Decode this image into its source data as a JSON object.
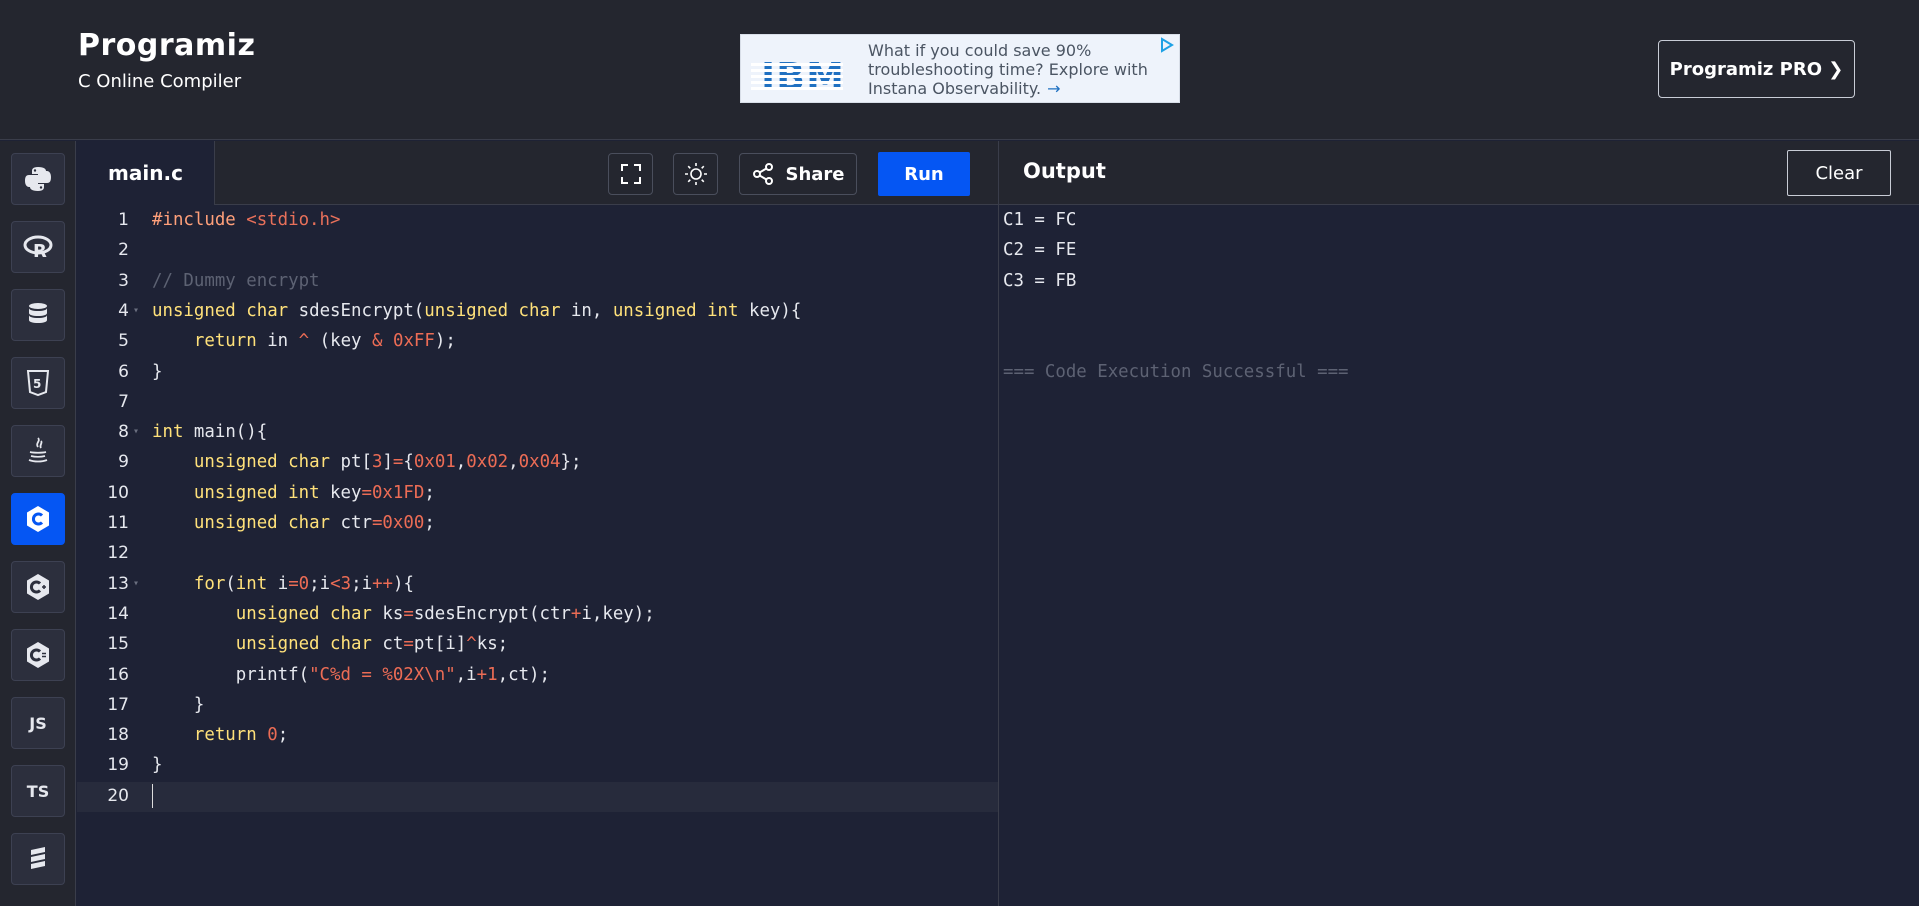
{
  "header": {
    "logo": "Programiz",
    "subtitle": "C Online Compiler",
    "pro_button": "Programiz PRO ❯"
  },
  "ad": {
    "brand": "IBM",
    "text": "What if you could save 90% troubleshooting time? Explore with Instana Observability.",
    "arrow": "→",
    "brand_color": "#1f70c1"
  },
  "sidebar": {
    "items": [
      {
        "name": "python",
        "icon": "python-icon"
      },
      {
        "name": "r",
        "icon": "r-icon"
      },
      {
        "name": "sql",
        "icon": "database-icon"
      },
      {
        "name": "html",
        "icon": "html5-icon"
      },
      {
        "name": "java",
        "icon": "java-icon"
      },
      {
        "name": "c",
        "icon": "c-icon",
        "active": true
      },
      {
        "name": "cpp",
        "icon": "cpp-icon"
      },
      {
        "name": "csharp",
        "icon": "csharp-icon"
      },
      {
        "name": "js",
        "label": "JS"
      },
      {
        "name": "ts",
        "label": "TS"
      },
      {
        "name": "swift",
        "icon": "stack-icon"
      }
    ]
  },
  "editor": {
    "tab": "main.c",
    "share_label": "Share",
    "run_label": "Run",
    "current_line": 20,
    "lines": [
      "#include <stdio.h>",
      "",
      "// Dummy encrypt",
      "unsigned char sdesEncrypt(unsigned char in, unsigned int key){",
      "    return in ^ (key & 0xFF);",
      "}",
      "",
      "int main(){",
      "    unsigned char pt[3]={0x01,0x02,0x04};",
      "    unsigned int key=0x1FD;",
      "    unsigned char ctr=0x00;",
      "",
      "    for(int i=0;i<3;i++){",
      "        unsigned char ks=sdesEncrypt(ctr+i,key);",
      "        unsigned char ct=pt[i]^ks;",
      "        printf(\"C%d = %02X\\n\",i+1,ct);",
      "    }",
      "    return 0;",
      "}",
      ""
    ],
    "fold_lines": [
      4,
      8,
      13
    ]
  },
  "output": {
    "title": "Output",
    "clear_label": "Clear",
    "lines": [
      "C1 = FC",
      "C2 = FE",
      "C3 = FB",
      "",
      "",
      "=== Code Execution Successful ==="
    ]
  },
  "colors": {
    "accent": "#0556f3",
    "background": "#1e2235",
    "header": "#24262f",
    "keyword": "#ffe17a",
    "number": "#ec6c55",
    "comment": "#5d6273"
  }
}
